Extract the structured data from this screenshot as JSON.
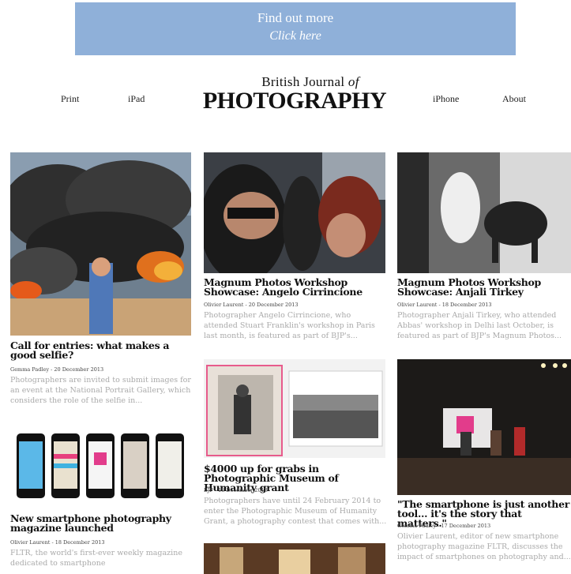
{
  "banner": {
    "line1": "Find out more",
    "line2": "Click here"
  },
  "nav": {
    "print": "Print",
    "ipad": "iPad",
    "iphone": "iPhone",
    "about": "About"
  },
  "logo": {
    "top": "British Journal ",
    "top_italic": "of",
    "main": "PHOTOGRAPHY"
  },
  "articles": [
    {
      "title": "Call for entries: what makes a good selfie?",
      "meta": "Gemma Padley - 20 December 2013",
      "excerpt": "Photographers are invited to submit images for an event at the National Portrait Gallery, which considers the role of the selfie in..."
    },
    {
      "title": "New smartphone photography magazine launched",
      "meta": "Olivier Laurent - 18 December 2013",
      "excerpt": "FLTR, the world's first-ever weekly magazine dedicated to smartphone"
    },
    {
      "title": "Magnum Photos Workshop Showcase: Angelo Cirrincione",
      "meta": "Olivier Laurent - 20 December 2013",
      "excerpt": "Photographer Angelo Cirrincione, who attended Stuart Franklin's workshop in Paris last month, is featured as part of BJP's..."
    },
    {
      "title": "$4000 up for grabs in Photographic Museum of Humanity grant",
      "meta": "BJP - 18 December 2013",
      "excerpt": "Photographers have until 24 February 2014 to enter the Photographic Museum of Humanity Grant, a photography contest that comes with..."
    },
    {
      "title": "Magnum Photos Workshop Showcase: Anjali Tirkey",
      "meta": "Olivier Laurent - 18 December 2013",
      "excerpt": "Photographer Anjali Tirkey, who attended Abbas' workshop in Delhi last October, is featured as part of BJP's Magnum Photos..."
    },
    {
      "title": "\"The smartphone is just another tool… it's the story that matters.\"",
      "meta": "Gemma Padley - 17 December 2013",
      "excerpt": "Olivier Laurent, editor of new smartphone photography magazine FLTR, discusses the impact of smartphones on photography and..."
    }
  ]
}
